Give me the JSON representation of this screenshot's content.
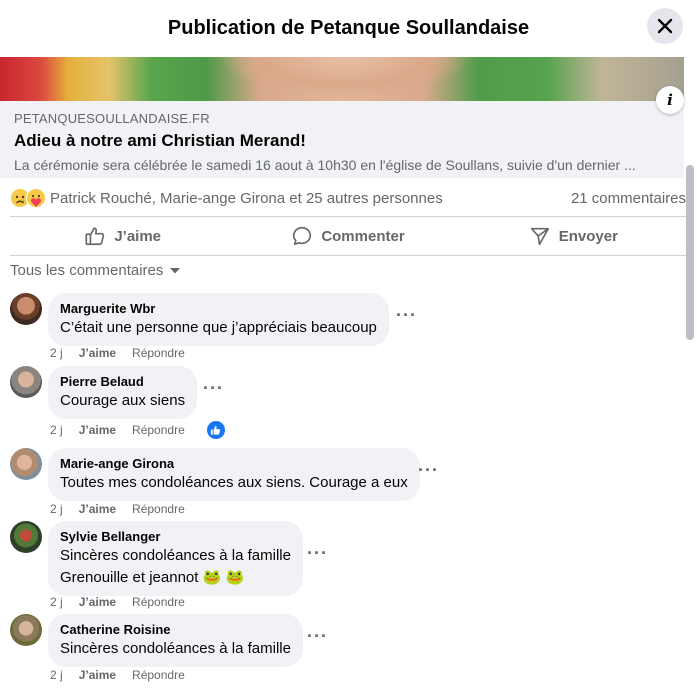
{
  "header": {
    "title": "Publication de Petanque Soullandaise",
    "close_icon": "close-icon"
  },
  "link_preview": {
    "domain": "PETANQUESOULLANDAISE.FR",
    "title": "Adieu à notre ami Christian Merand!",
    "description": "La cérémonie sera célébrée le samedi 16 aout à 10h30 en l'église de Soullans, suivie d'un dernier ...",
    "info_label": "i"
  },
  "reactions": {
    "text": "Patrick Rouché, Marie-ange Girona et 25 autres personnes",
    "comments_count": "21 commentaires",
    "icons": [
      "sad-emoji-icon",
      "care-emoji-icon"
    ]
  },
  "actions": {
    "like": "J’aime",
    "comment": "Commenter",
    "send": "Envoyer"
  },
  "filter": {
    "label": "Tous les commentaires"
  },
  "comments": [
    {
      "author": "Marguerite Wbr",
      "text": "C’était une personne que j’appréciais beaucoup",
      "time": "2 j",
      "like": "J’aime",
      "reply": "Répondre"
    },
    {
      "author": "Pierre Belaud",
      "text": "Courage aux siens",
      "time": "2 j",
      "like": "J’aime",
      "reply": "Répondre"
    },
    {
      "author": "Marie-ange Girona",
      "text": "Toutes mes condoléances aux siens. Courage a eux",
      "time": "2 j",
      "like": "J’aime",
      "reply": "Répondre"
    },
    {
      "author": "Sylvie Bellanger",
      "text": "Sincères condoléances à la famille",
      "text2": "Grenouille et jeannot 🐸 🐸",
      "time": "2 j",
      "like": "J’aime",
      "reply": "Répondre"
    },
    {
      "author": "Catherine Roisine",
      "text": "Sincères condoléances à la famille",
      "time": "2 j",
      "like": "J’aime",
      "reply": "Répondre"
    }
  ],
  "more_label": "···",
  "colors": {
    "accent": "#1877f2",
    "secondary_text": "#65676b",
    "bubble": "#f0f2f5"
  }
}
